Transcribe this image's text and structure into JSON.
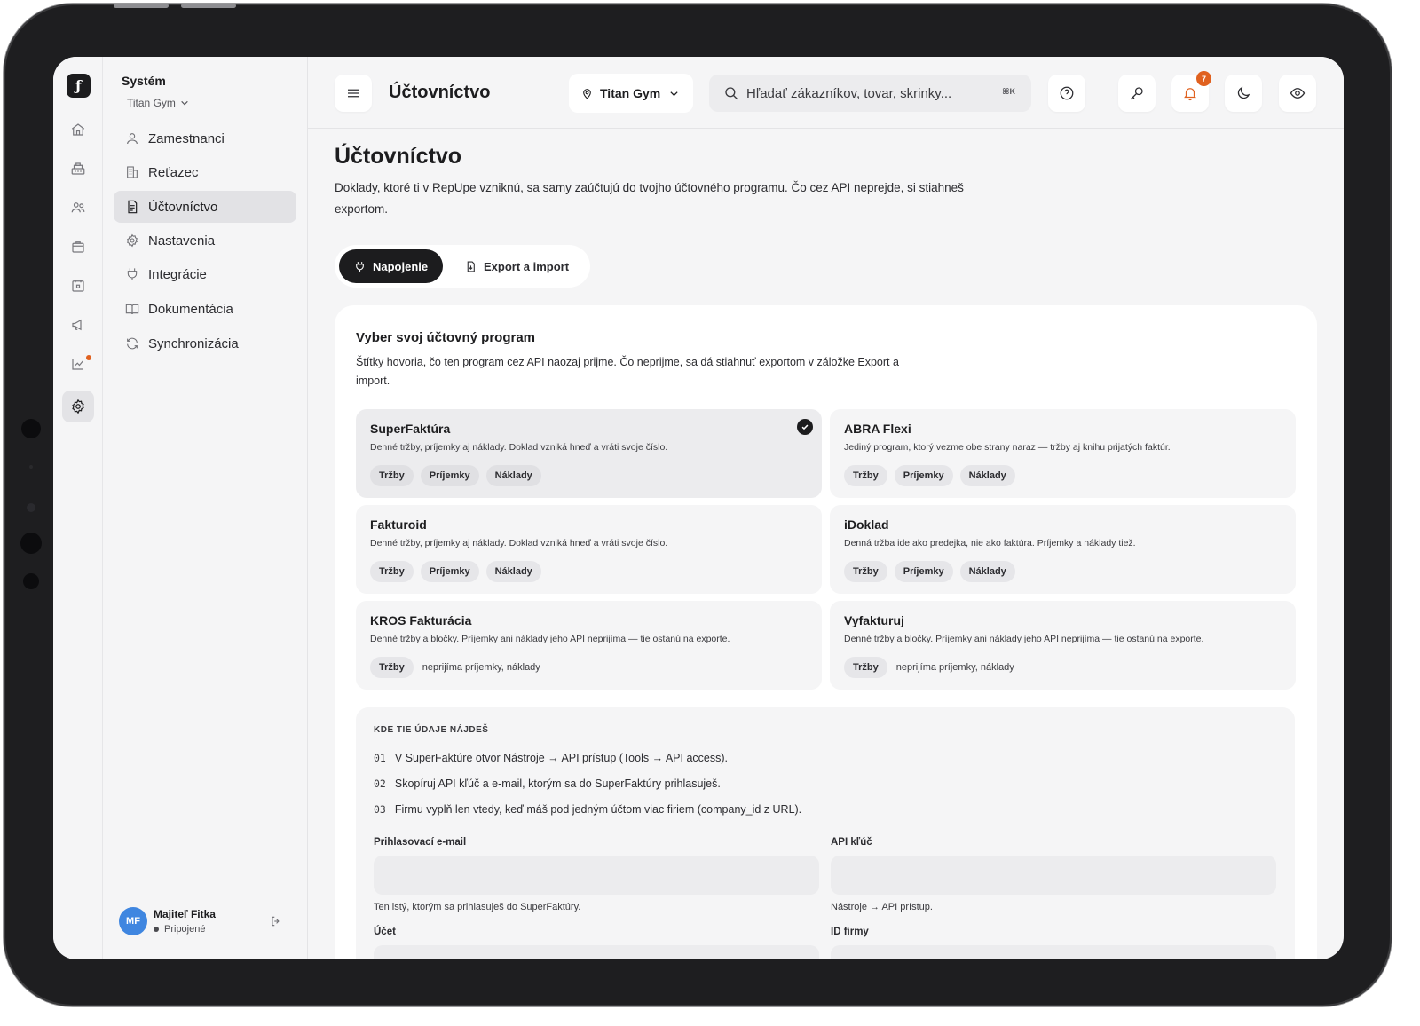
{
  "app": {
    "logo_glyph": "ƒ",
    "accent_color": "#e0611f",
    "dark_color": "#1c1c1e"
  },
  "rail": {
    "items": [
      {
        "icon": "home-icon"
      },
      {
        "icon": "cash-register-icon"
      },
      {
        "icon": "users-icon"
      },
      {
        "icon": "store-icon"
      },
      {
        "icon": "calendar-icon"
      },
      {
        "icon": "megaphone-icon"
      },
      {
        "icon": "chart-line-icon",
        "has_dot": true
      },
      {
        "icon": "gear-icon",
        "active": true
      }
    ]
  },
  "sidebar": {
    "title": "Systém",
    "org": "Titan Gym",
    "items": [
      {
        "label": "Zamestnanci",
        "icon": "user-icon"
      },
      {
        "label": "Reťazec",
        "icon": "building-icon"
      },
      {
        "label": "Účtovníctvo",
        "icon": "document-icon",
        "active": true
      },
      {
        "label": "Nastavenia",
        "icon": "gear-icon"
      },
      {
        "label": "Integrácie",
        "icon": "plug-icon"
      },
      {
        "label": "Dokumentácia",
        "icon": "book-icon"
      },
      {
        "label": "Synchronizácia",
        "icon": "sync-icon"
      }
    ],
    "user": {
      "initials": "MF",
      "name": "Majiteľ Fitka",
      "status": "Pripojené"
    }
  },
  "topbar": {
    "title": "Účtovníctvo",
    "location": "Titan Gym",
    "search_placeholder": "Hľadať zákazníkov, tovar, skrinky...",
    "search_shortcut": "⌘K",
    "notification_count": "7"
  },
  "main": {
    "title": "Účtovníctvo",
    "description": "Doklady, ktoré ti v RepUpe vzniknú, sa samy zaúčtujú do tvojho účtovného programu. Čo cez API neprejde, si stiahneš exportom.",
    "tabs": [
      {
        "label": "Napojenie",
        "active": true
      },
      {
        "label": "Export a import",
        "active": false
      }
    ],
    "panel": {
      "title": "Vyber svoj účtovný program",
      "description": "Štítky hovoria, čo ten program cez API naozaj prijme. Čo neprijme, sa dá stiahnuť exportom v záložke Export a import.",
      "programs": [
        {
          "name": "SuperFaktúra",
          "desc": "Denné tržby, príjemky aj náklady. Doklad vzniká hneď a vráti svoje číslo.",
          "tags": [
            "Tržby",
            "Príjemky",
            "Náklady"
          ],
          "note": "",
          "selected": true
        },
        {
          "name": "ABRA Flexi",
          "desc": "Jediný program, ktorý vezme obe strany naraz — tržby aj knihu prijatých faktúr.",
          "tags": [
            "Tržby",
            "Príjemky",
            "Náklady"
          ],
          "note": "",
          "selected": false
        },
        {
          "name": "Fakturoid",
          "desc": "Denné tržby, príjemky aj náklady. Doklad vzniká hneď a vráti svoje číslo.",
          "tags": [
            "Tržby",
            "Príjemky",
            "Náklady"
          ],
          "note": "",
          "selected": false
        },
        {
          "name": "iDoklad",
          "desc": "Denná tržba ide ako predejka, nie ako faktúra. Príjemky a náklady tiež.",
          "tags": [
            "Tržby",
            "Príjemky",
            "Náklady"
          ],
          "note": "",
          "selected": false
        },
        {
          "name": "KROS Fakturácia",
          "desc": "Denné tržby a bločky. Príjemky ani náklady jeho API neprijíma — tie ostanú na exporte.",
          "tags": [
            "Tržby"
          ],
          "note": "neprijíma príjemky, náklady",
          "selected": false
        },
        {
          "name": "Vyfakturuj",
          "desc": "Denné tržby a bločky. Príjemky ani náklady jeho API neprijíma — tie ostanú na exporte.",
          "tags": [
            "Tržby"
          ],
          "note": "neprijíma príjemky, náklady",
          "selected": false
        }
      ],
      "help": {
        "heading": "KDE TIE ÚDAJE NÁJDEŠ",
        "steps": [
          {
            "num": "01",
            "text": "V SuperFaktúre otvor Nástroje → API prístup (Tools → API access)."
          },
          {
            "num": "02",
            "text": "Skopíruj API kľúč a e-mail, ktorým sa do SuperFaktúry prihlasuješ."
          },
          {
            "num": "03",
            "text": "Firmu vyplň len vtedy, keď máš pod jedným účtom viac firiem (company_id z URL)."
          }
        ],
        "fields": [
          {
            "label": "Prihlasovací e-mail",
            "value": "",
            "hint": "Ten istý, ktorým sa prihlasuješ do SuperFaktúry."
          },
          {
            "label": "API kľúč",
            "value": "",
            "hint": "Nástroje → API prístup."
          },
          {
            "label": "Účet",
            "value": "",
            "hint": ""
          },
          {
            "label": "ID firmy",
            "value": "",
            "hint": ""
          }
        ]
      }
    }
  }
}
